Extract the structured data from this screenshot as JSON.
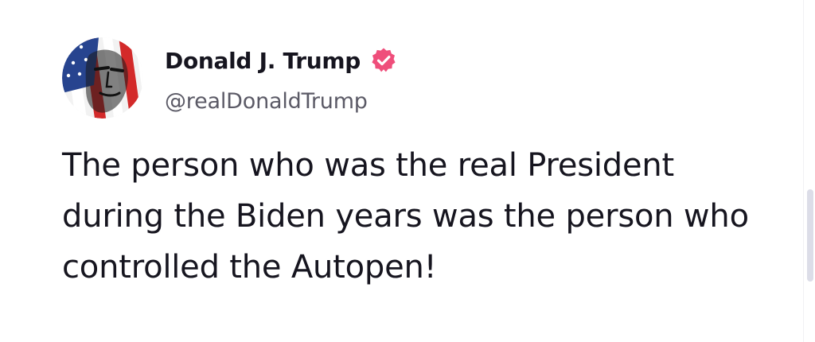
{
  "post": {
    "author": {
      "display_name": "Donald J. Trump",
      "handle": "@realDonaldTrump",
      "verified": true,
      "verified_icon": "verified-badge-icon",
      "verified_color": "#ef4e7b",
      "avatar_description_icon": "avatar-image"
    },
    "body": "The person who was the real President during the Biden years was the person who controlled the Autopen!"
  },
  "colors": {
    "text": "#16151f",
    "handle": "#5b5a66",
    "background": "#ffffff",
    "scrollbar_thumb": "#dcdde8"
  }
}
